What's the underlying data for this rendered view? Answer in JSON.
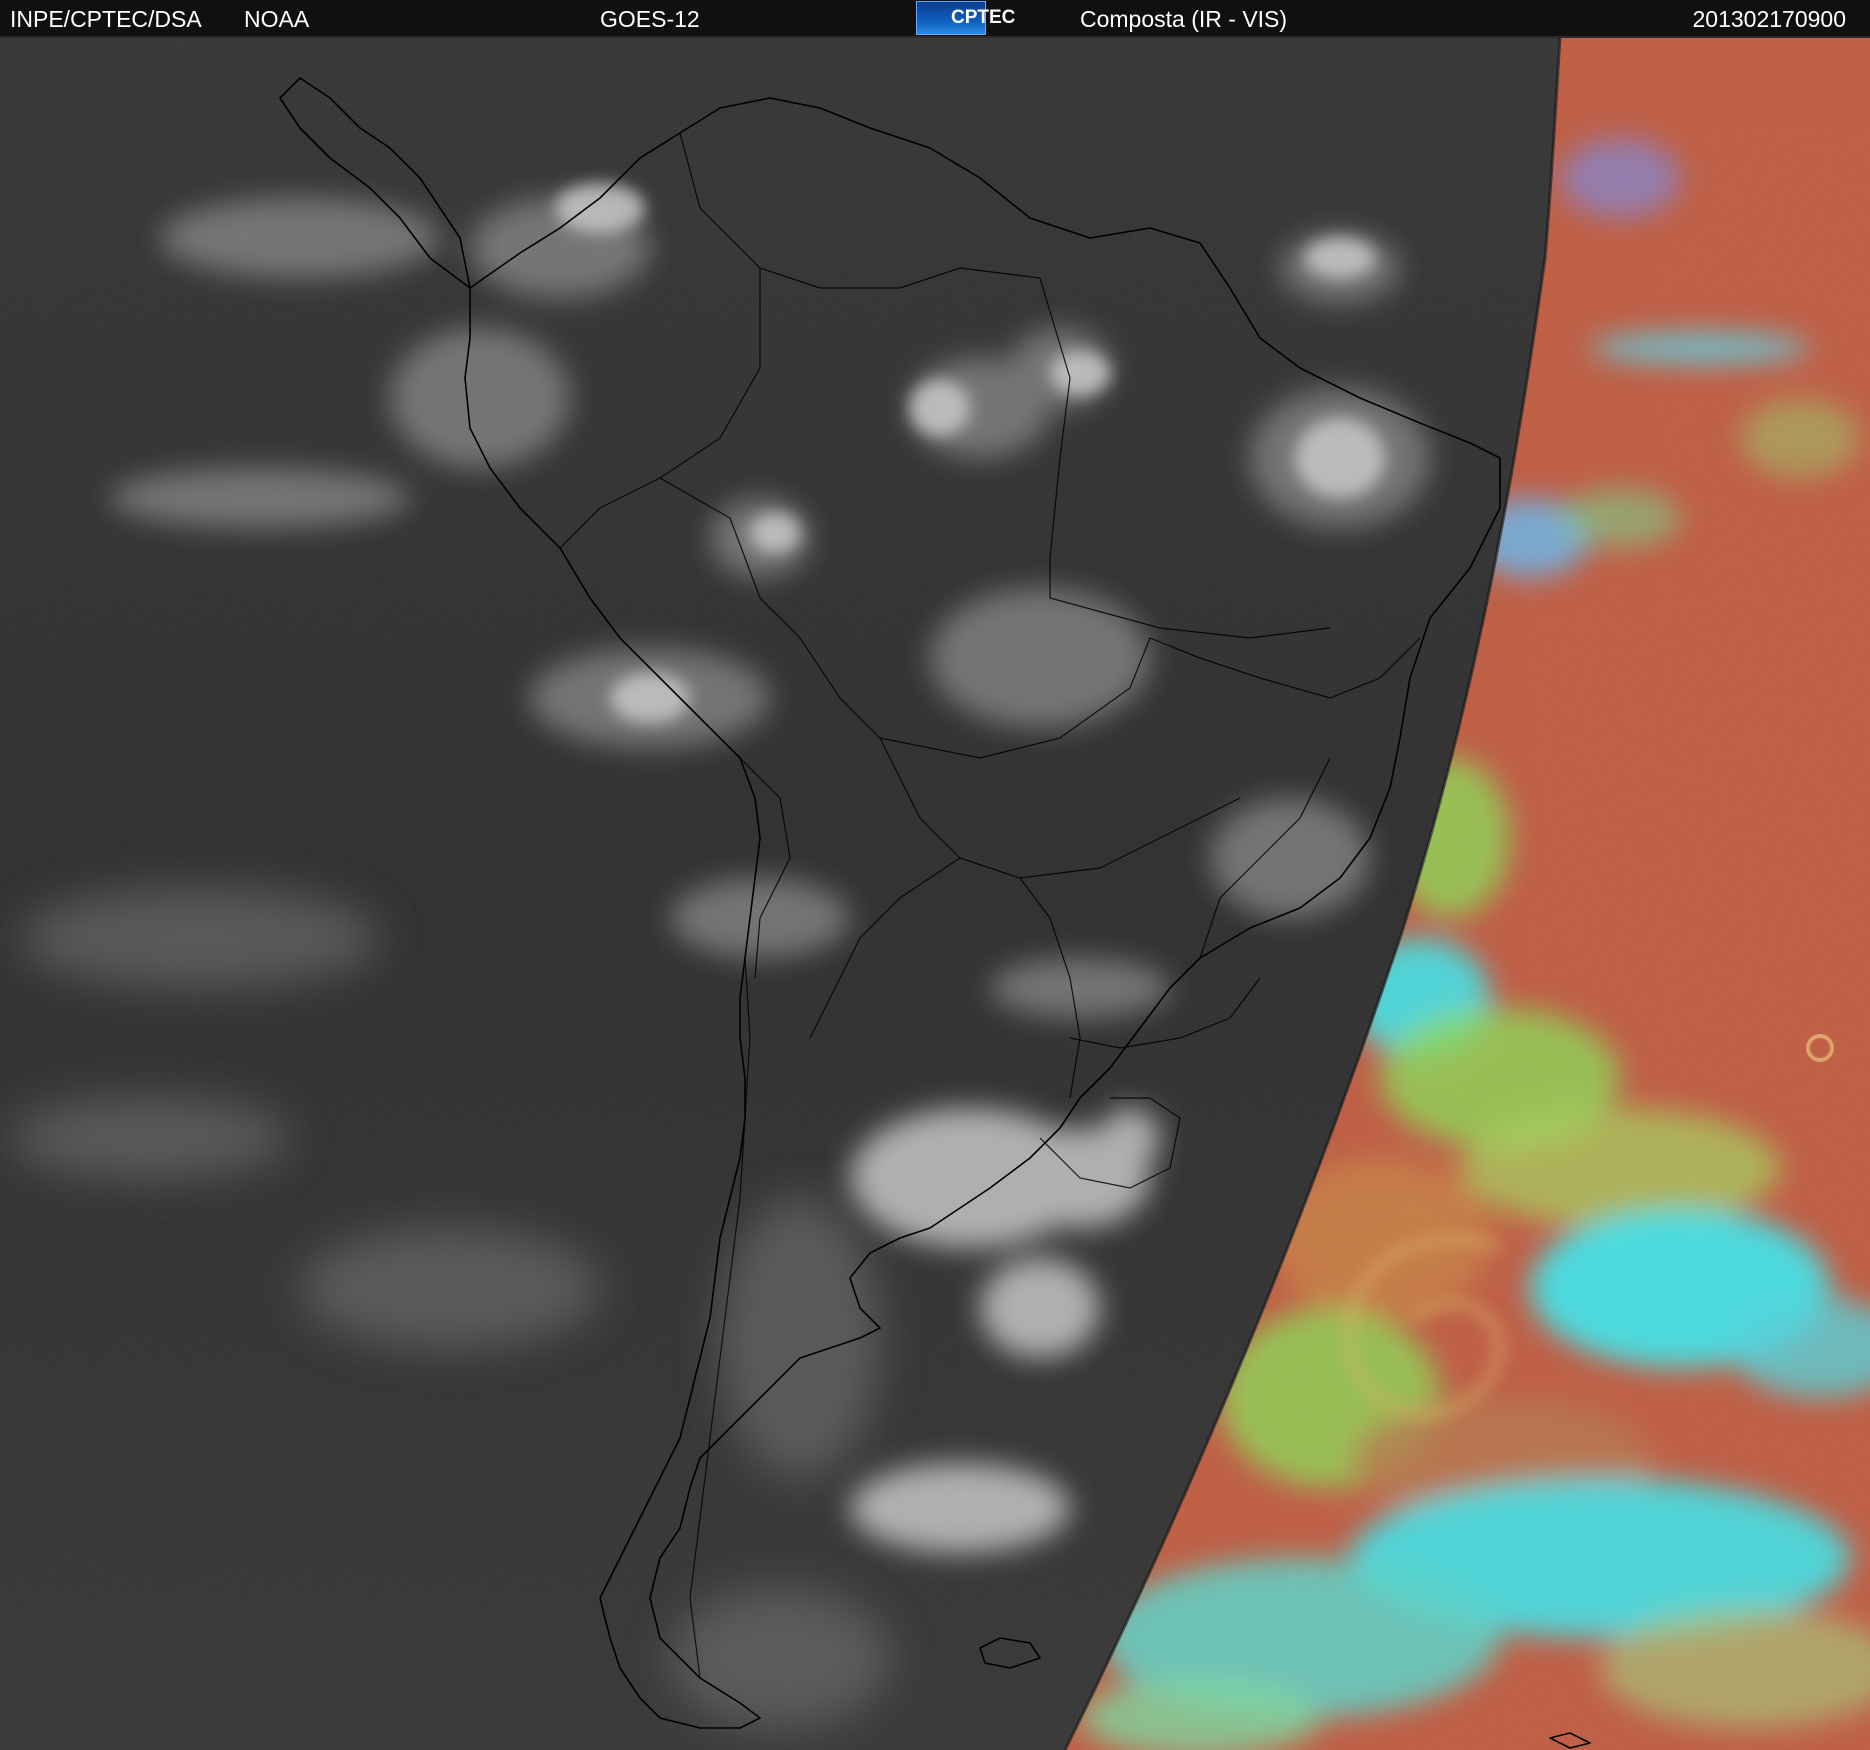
{
  "header": {
    "agency": "INPE/CPTEC/DSA",
    "partner": "NOAA",
    "satellite": "GOES-12",
    "logo_text": "CPTEC",
    "product": "Composta (IR - VIS)",
    "timestamp": "201302170900"
  },
  "colors": {
    "ir_background": "#2f2f2f",
    "vis_ocean": "#c0593e",
    "cloud_cyan": "#47e0e6",
    "cloud_green": "#8fd65a",
    "coastline": "#000000"
  }
}
